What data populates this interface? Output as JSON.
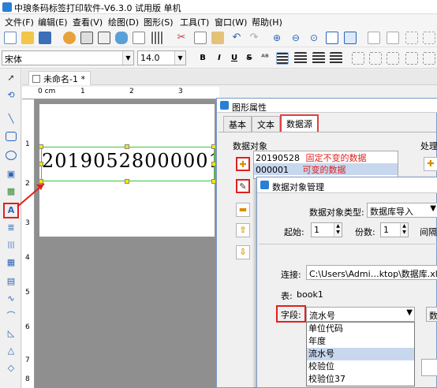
{
  "window": {
    "title": "中琅条码标签打印软件-V6.3.0 试用版 单机"
  },
  "menu": [
    "文件(F)",
    "编辑(E)",
    "查看(V)",
    "绘图(D)",
    "图形(S)",
    "工具(T)",
    "窗口(W)",
    "帮助(H)"
  ],
  "format_bar": {
    "font_name": "宋体",
    "font_size": "14.0",
    "bold": "B",
    "italic": "I",
    "underline": "U",
    "strike": "S"
  },
  "document": {
    "tab_label": "未命名-1 *",
    "ruler_unit": "0 cm",
    "ruler_marks_h": [
      "1",
      "2",
      "3"
    ],
    "ruler_marks_v": [
      "1",
      "2",
      "3",
      "4",
      "5",
      "6",
      "7",
      "8"
    ],
    "label_text": "20190528000001"
  },
  "prop_dialog": {
    "title": "图形属性",
    "tabs": [
      "基本",
      "文本",
      "数据源"
    ],
    "active_tab": "数据源",
    "section_label": "数据对象",
    "right_section_label": "处理",
    "items": [
      {
        "value": "20190528",
        "annotation": "固定不变的数据"
      },
      {
        "value": "000001",
        "annotation": "可变的数据"
      }
    ]
  },
  "source_dialog": {
    "title": "数据对象管理",
    "type_label": "数据对象类型:",
    "type_value": "数据库导入",
    "start_label": "起始:",
    "start_value": "1",
    "copies_label": "份数:",
    "copies_value": "1",
    "interval_label": "间隔",
    "conn_label": "连接:",
    "conn_value": "C:\\Users\\Admi…ktop\\数据库.xlsx",
    "table_label": "表:",
    "table_value": "book1",
    "field_label": "字段:",
    "field_value": "流水号",
    "field_options": [
      "单位代码",
      "年度",
      "流水号",
      "校验位",
      "校验位37"
    ],
    "selected_option": "流水号",
    "side_btn_label": "数"
  },
  "colors": {
    "accent": "#e0211d",
    "selection": "#c7d7ee",
    "green_frame": "#3bc43b"
  }
}
